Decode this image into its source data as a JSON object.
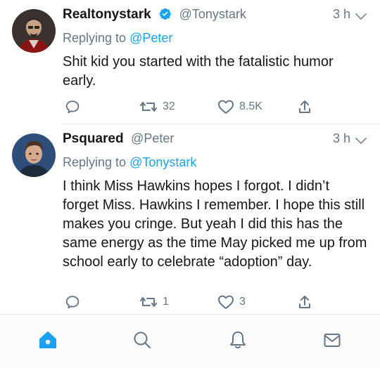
{
  "tweets": [
    {
      "name": "Realtonystark",
      "handle": "@Tonystark",
      "verified": true,
      "time": "3 h",
      "replying_prefix": "Replying to",
      "replying_to": "@Peter",
      "text": "Shit kid you started with the fatalistic humor early.",
      "retweets": "32",
      "likes": "8.5K"
    },
    {
      "name": "Psquared",
      "handle": "@Peter",
      "verified": false,
      "time": "3 h",
      "replying_prefix": "Replying to",
      "replying_to": "@Tonystark",
      "text": "I think Miss Hawkins hopes I forgot. I didn’t forget Miss. Hawkins I remember. I hope this still makes you cringe. But yeah I did this has the same energy as the time May picked me up from school early to celebrate “adoption” day.",
      "retweets": "1",
      "likes": "3"
    }
  ],
  "tabbar": {
    "items": [
      "home-icon",
      "search-icon",
      "notifications-icon",
      "messages-icon"
    ],
    "active": "home-icon"
  },
  "colors": {
    "accent": "#1da1f2",
    "secondary_text": "#657786",
    "divider": "#e1e8ed"
  }
}
